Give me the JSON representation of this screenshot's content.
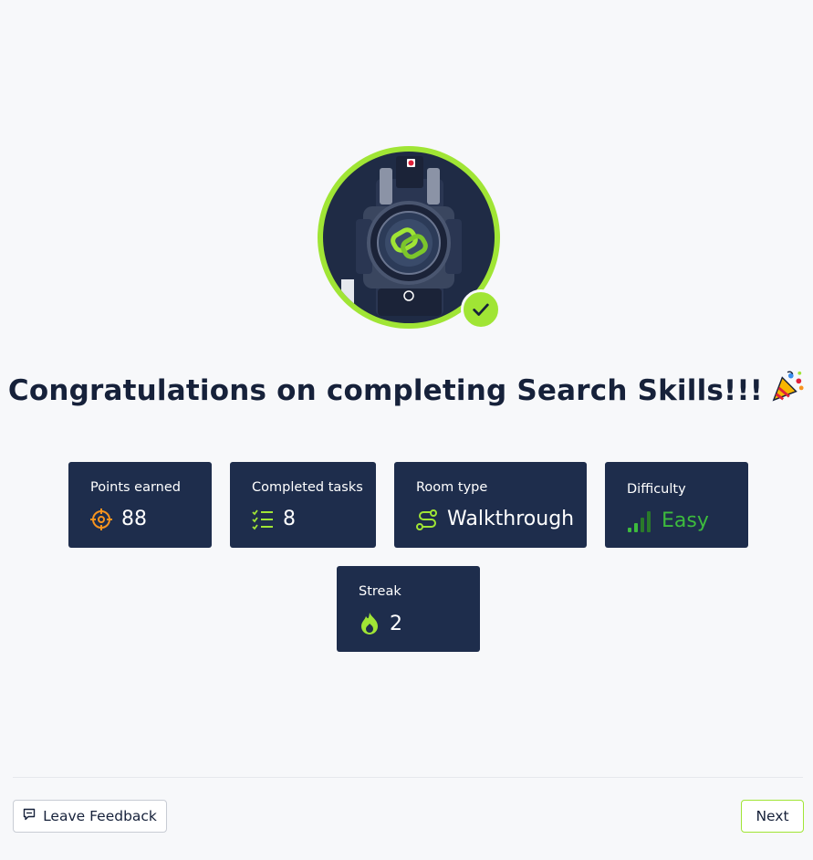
{
  "badge": {
    "icon": "room-badge-image",
    "completed_icon": "check-icon",
    "accent_color": "#a0e535"
  },
  "title": "Congratulations on completing Search Skills!!!",
  "title_icon": "party-popper-icon",
  "stats": {
    "points": {
      "label": "Points earned",
      "value": "88",
      "icon": "target-icon",
      "color": "#f7931e"
    },
    "tasks": {
      "label": "Completed tasks",
      "value": "8",
      "icon": "checklist-icon",
      "color": "#a0e535"
    },
    "room_type": {
      "label": "Room type",
      "value": "Walkthrough",
      "icon": "route-icon",
      "color": "#a0e535"
    },
    "difficulty": {
      "label": "Difficulty",
      "value": "Easy",
      "icon": "signal-bars-icon",
      "color": "#3dbb3d"
    },
    "streak": {
      "label": "Streak",
      "value": "2",
      "icon": "flame-icon",
      "color": "#a0e535"
    }
  },
  "footer": {
    "feedback_label": "Leave Feedback",
    "feedback_icon": "feedback-icon",
    "next_label": "Next"
  },
  "colors": {
    "card_background": "#1e2d4c",
    "page_background": "#f7f8fa",
    "text_dark": "#16213a"
  }
}
